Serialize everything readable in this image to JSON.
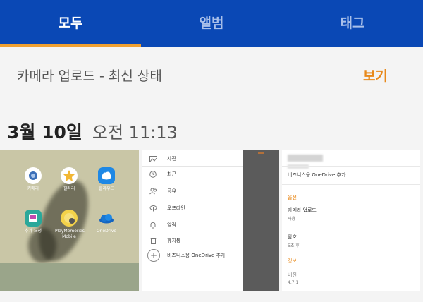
{
  "tabs": [
    {
      "label": "모두",
      "active": true
    },
    {
      "label": "앨범",
      "active": false
    },
    {
      "label": "태그",
      "active": false
    }
  ],
  "upload": {
    "title": "카메라 업로드 - 최신 상태",
    "action": "보기"
  },
  "date_group": {
    "day": "3월 10일",
    "time": "오전 11:13"
  },
  "thumb_home": {
    "apps": [
      {
        "label": "카메라"
      },
      {
        "label": "갤러리"
      },
      {
        "label": "클라우드"
      },
      {
        "label": "추가 요청"
      },
      {
        "label": "PlayMemories Mobile"
      },
      {
        "label": "OneDrive"
      }
    ]
  },
  "thumb_menu": {
    "items": [
      {
        "label": "사진",
        "icon": "image-icon"
      },
      {
        "label": "최근",
        "icon": "clock-icon"
      },
      {
        "label": "공유",
        "icon": "people-icon"
      },
      {
        "label": "오프라인",
        "icon": "offline-icon"
      },
      {
        "label": "알림",
        "icon": "bell-icon"
      },
      {
        "label": "휴지통",
        "icon": "trash-icon"
      },
      {
        "label": "비즈니스용 OneDrive 추가",
        "icon": "plus-icon"
      }
    ]
  },
  "thumb_settings": {
    "business_add": "비즈니스용 OneDrive 추가",
    "section_options": "옵션",
    "camera_upload": "카메라 업로드",
    "camera_upload_state": "사용",
    "passcode": "암호",
    "passcode_value": "5초 후",
    "section_info": "정보",
    "version_label": "버전",
    "version_value": "4.7.1"
  },
  "colors": {
    "tabbar": "#0a48b5",
    "accent": "#f0a030",
    "action": "#e8891b"
  }
}
